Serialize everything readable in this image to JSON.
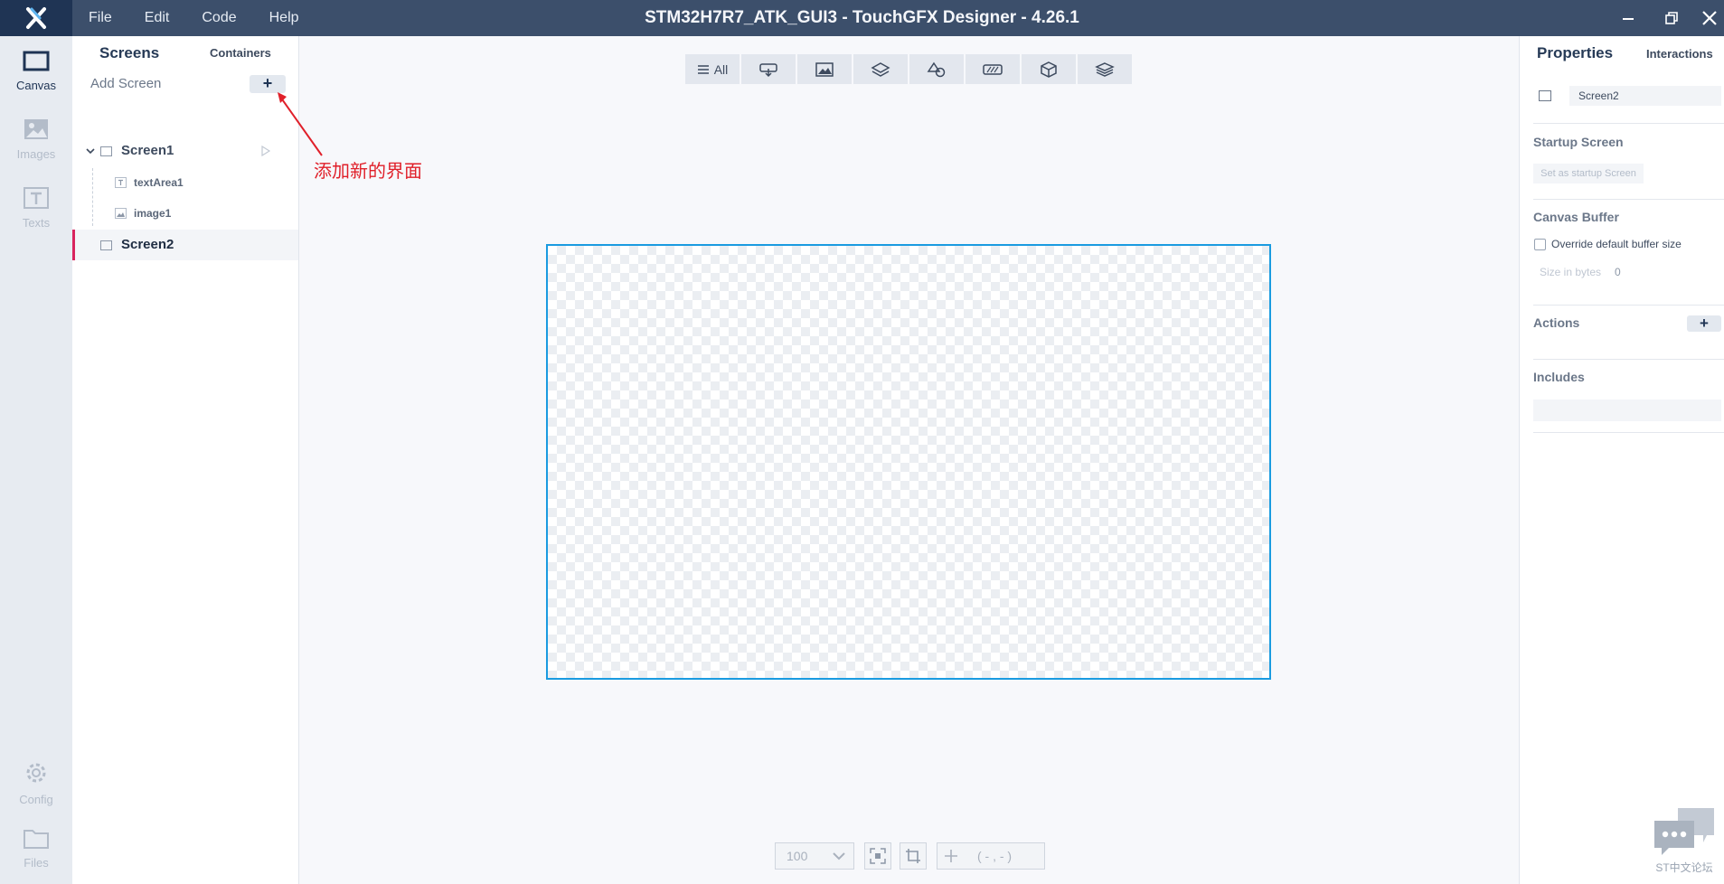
{
  "app": {
    "title": "STM32H7R7_ATK_GUI3 - TouchGFX Designer - 4.26.1",
    "menu": [
      "File",
      "Edit",
      "Code",
      "Help"
    ]
  },
  "rail": {
    "canvas": "Canvas",
    "images": "Images",
    "texts": "Texts",
    "config": "Config",
    "files": "Files"
  },
  "screens_panel": {
    "tab_screens": "Screens",
    "tab_containers": "Containers",
    "add_screen_label": "Add Screen",
    "add_button": "+",
    "tree": {
      "screen1": "Screen1",
      "text_area": "textArea1",
      "image": "image1",
      "screen2": "Screen2"
    }
  },
  "annotation": "添加新的界面",
  "toolbar": {
    "all_label": "All",
    "icons": [
      "interaction-icon",
      "image-icon",
      "layers-icon",
      "shapes-icon",
      "progress-icon",
      "cube-icon",
      "stack-icon"
    ]
  },
  "bottom": {
    "zoom": "100",
    "coords": "( - , - )"
  },
  "properties": {
    "title": "Properties",
    "interactions_tab": "Interactions",
    "screen_name": "Screen2",
    "startup_section": "Startup Screen",
    "startup_button": "Set as startup Screen",
    "canvas_buffer_section": "Canvas Buffer",
    "override_label": "Override default buffer size",
    "override_checked": false,
    "size_label": "Size in bytes",
    "size_value": "0",
    "actions_section": "Actions",
    "actions_add": "+",
    "includes_section": "Includes"
  },
  "watermark": "ST中文论坛",
  "colors": {
    "titlebar": "#3c4f6b",
    "logo_bg": "#1f3454",
    "selection_accent": "#d9245e",
    "canvas_border": "#1a9be0",
    "annotation": "#e0202a"
  }
}
